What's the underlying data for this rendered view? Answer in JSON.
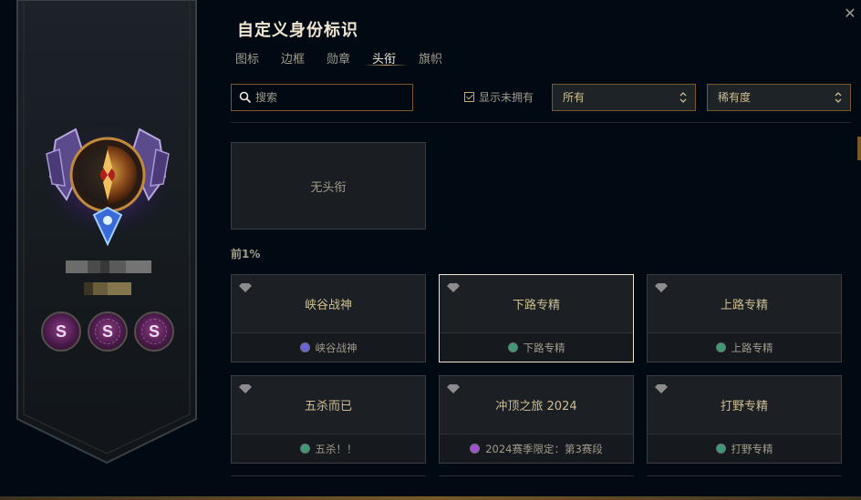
{
  "header": {
    "title": "自定义身份标识",
    "close_icon": "close-icon"
  },
  "tabs": [
    {
      "label": "图标",
      "active": false
    },
    {
      "label": "边框",
      "active": false
    },
    {
      "label": "勋章",
      "active": false
    },
    {
      "label": "头衔",
      "active": true
    },
    {
      "label": "旗帜",
      "active": false
    }
  ],
  "search": {
    "placeholder": "搜索",
    "value": "",
    "icon": "search-icon"
  },
  "filters": {
    "show_unowned": {
      "label": "显示未拥有",
      "checked": true
    },
    "ownership_select": {
      "value": "所有"
    },
    "sort_select": {
      "value": "稀有度"
    }
  },
  "profile": {
    "badges": [
      {
        "label": "S"
      },
      {
        "label": "S"
      },
      {
        "label": "S"
      }
    ]
  },
  "titles": {
    "none_label": "无头衔",
    "section_label": "前1%",
    "cards": [
      {
        "name": "峡谷战神",
        "source": "峡谷战神",
        "dot_color": "#6a63d8",
        "selected": false
      },
      {
        "name": "下路专精",
        "source": "下路专精",
        "dot_color": "#3e9a74",
        "selected": true
      },
      {
        "name": "上路专精",
        "source": "上路专精",
        "dot_color": "#3e9a74",
        "selected": false
      },
      {
        "name": "五杀而已",
        "source": "五杀！！",
        "dot_color": "#3e9a74",
        "selected": false
      },
      {
        "name": "冲顶之旅 2024",
        "source": "2024赛季限定：第3赛段",
        "dot_color": "#a24fd1",
        "selected": false
      },
      {
        "name": "打野专精",
        "source": "打野专精",
        "dot_color": "#3e9a74",
        "selected": false
      }
    ]
  },
  "colors": {
    "accent_gold": "#c8aa6e",
    "border_gold": "#785a28",
    "background": "#010a13"
  }
}
